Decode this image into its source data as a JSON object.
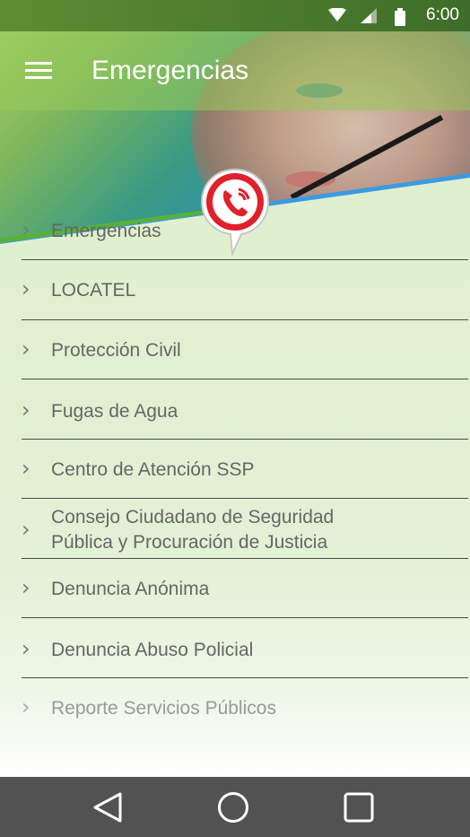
{
  "status_bar": {
    "time": "6:00",
    "icons": [
      "wifi-icon",
      "signal-icon",
      "battery-icon"
    ]
  },
  "app_bar": {
    "title": "Emergencias",
    "menu_icon": "hamburger-menu-icon"
  },
  "colors": {
    "accent_red": "#e0202a",
    "app_bar_green": "#8dc03f",
    "divider": "#4b4b4b",
    "nav_bar": "#525252"
  },
  "list": {
    "items": [
      {
        "label": "Emergencias"
      },
      {
        "label": "LOCATEL"
      },
      {
        "label": "Protección Civil"
      },
      {
        "label": "Fugas de Agua"
      },
      {
        "label": "Centro de Atención SSP"
      },
      {
        "label": "Consejo Ciudadano de Seguridad Pública y Procuración de Justicia",
        "line1": "Consejo Ciudadano de Seguridad",
        "line2": "Pública y Procuración de Justicia"
      },
      {
        "label": "Denuncia Anónima"
      },
      {
        "label": "Denuncia Abuso Policial"
      },
      {
        "label": "Reporte Servicios Públicos"
      }
    ]
  },
  "nav_bar": {
    "buttons": [
      "back-icon",
      "home-icon",
      "recents-icon"
    ]
  }
}
